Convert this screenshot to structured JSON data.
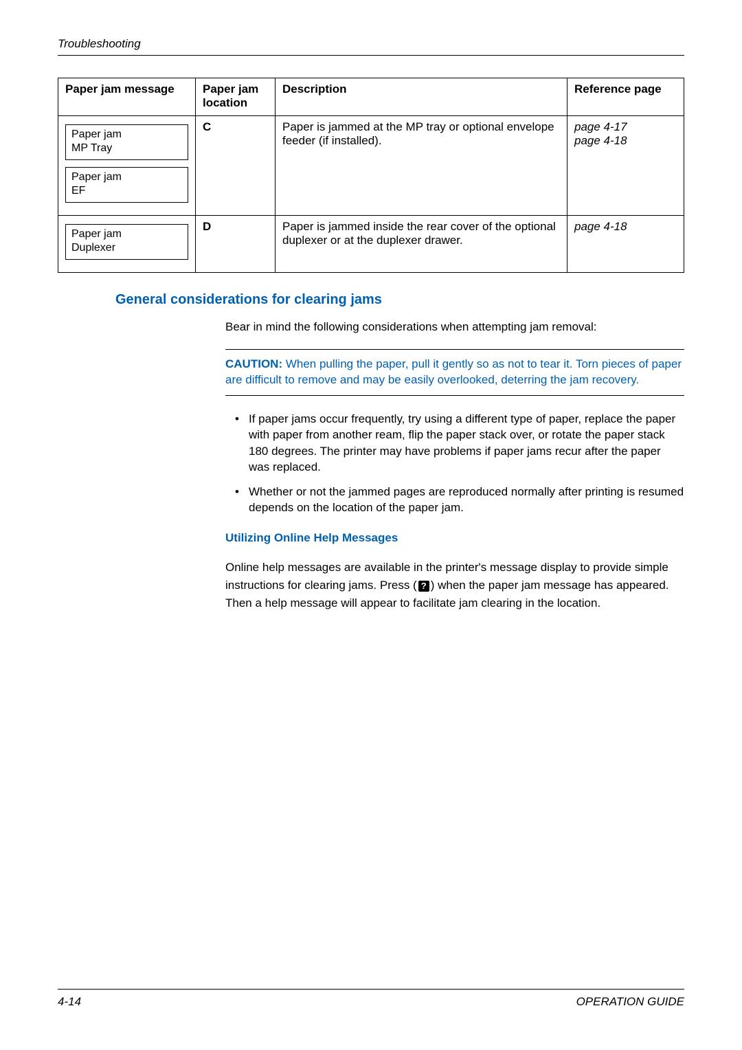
{
  "header": {
    "title": "Troubleshooting"
  },
  "table": {
    "headers": {
      "message": "Paper jam message",
      "location": "Paper jam location",
      "description": "Description",
      "reference": "Reference page"
    },
    "rows": [
      {
        "messages": [
          {
            "line1": "Paper jam",
            "line2": "MP Tray"
          },
          {
            "line1": "Paper jam",
            "line2": "EF"
          }
        ],
        "location": "C",
        "description": "Paper is jammed at the MP tray or optional envelope feeder (if installed).",
        "references": [
          "page 4-17",
          "page 4-18"
        ]
      },
      {
        "messages": [
          {
            "line1": "Paper jam",
            "line2": "Duplexer"
          }
        ],
        "location": "D",
        "description": "Paper is jammed inside the rear cover of the optional duplexer or at the duplexer drawer.",
        "references": [
          "page 4-18"
        ]
      }
    ]
  },
  "section": {
    "heading": "General considerations for clearing jams",
    "intro": "Bear in mind the following considerations when attempting jam removal:",
    "caution_label": "CAUTION:",
    "caution_body": " When pulling the paper, pull it gently so as not to tear it. Torn pieces of paper are difficult to remove and may be easily overlooked, deterring the jam recovery.",
    "bullets": [
      "If paper jams occur frequently, try using a different type of paper, replace the paper with paper from another ream, flip the paper stack over, or rotate the paper stack 180 degrees. The printer may have problems if paper jams recur after the paper was replaced.",
      "Whether or not the jammed pages are reproduced normally after printing is resumed depends on the location of the paper jam."
    ],
    "sub_heading": "Utilizing Online Help Messages",
    "online_a": "Online help messages are available in the printer's message display to provide simple instructions for clearing jams. Press (",
    "help_icon": "?",
    "online_b": ") when the paper jam message has appeared. Then a help message will appear to facilitate jam clearing in the location."
  },
  "footer": {
    "page": "4-14",
    "guide": "OPERATION GUIDE"
  }
}
